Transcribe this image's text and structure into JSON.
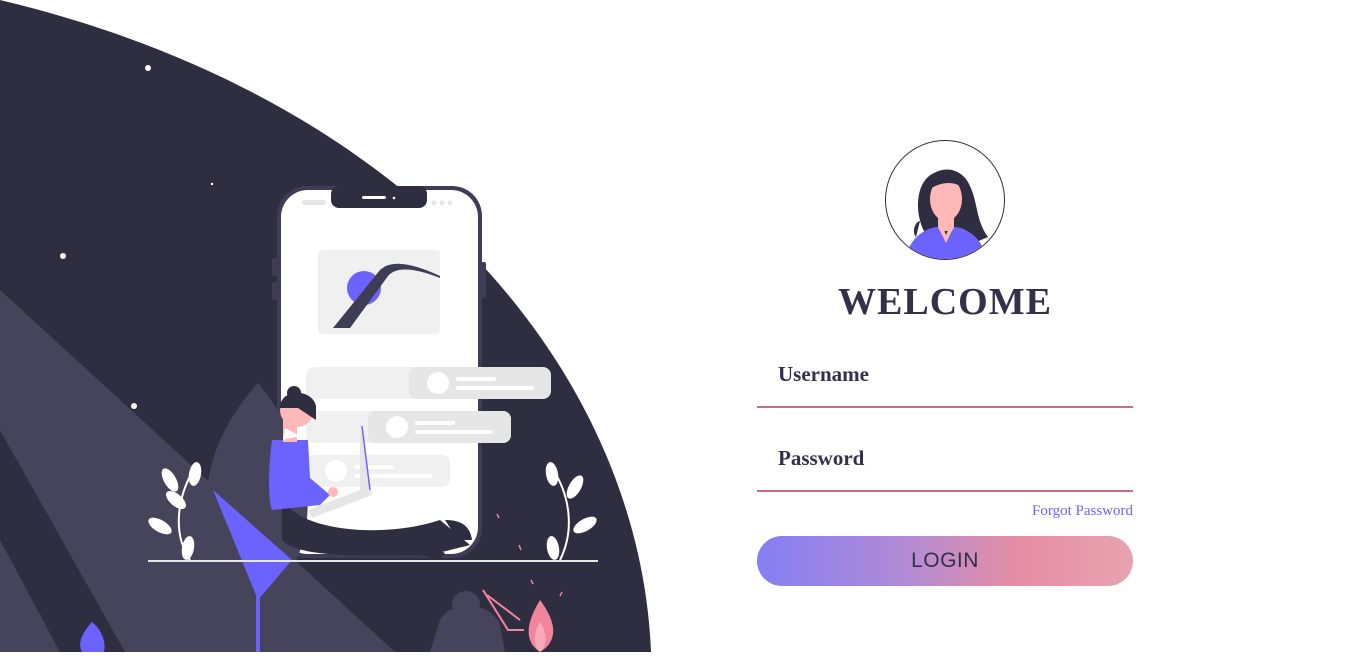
{
  "login": {
    "title": "WELCOME",
    "username_label": "Username",
    "password_label": "Password",
    "username_value": "",
    "password_value": "",
    "forgot_password": "Forgot Password",
    "login_button": "LOGIN"
  },
  "colors": {
    "dark": "#2f2e41",
    "accent": "#6c63ff",
    "pink": "#d1698a",
    "skin": "#ffb8b8"
  },
  "icons": {
    "avatar": "woman-avatar-icon",
    "illustration": "woman-with-laptop-and-phone-illustration"
  }
}
